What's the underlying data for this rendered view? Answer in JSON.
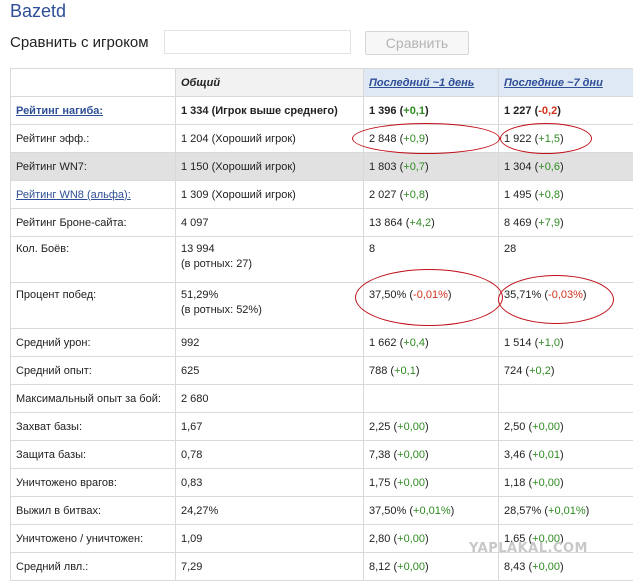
{
  "player": {
    "name": "Bazetd"
  },
  "compare": {
    "label": "Сравнить с игроком",
    "input_value": "",
    "button_label": "Сравнить"
  },
  "table": {
    "headers": {
      "label": "",
      "total": "Общий",
      "day": "Последний ~1 день",
      "week": "Последние ~7 дни"
    },
    "rows": [
      {
        "label": "Рейтинг нагиба:",
        "total": "1 334 (Игрок выше среднего)",
        "day": "1 396",
        "day_delta": "+0,1",
        "day_sign": "pos",
        "week": "1 227",
        "week_delta": "-0,2",
        "week_sign": "neg"
      },
      {
        "label": "Рейтинг эфф.:",
        "total": "1 204 (Хороший игрок)",
        "day": "2 848",
        "day_delta": "+0,9",
        "day_sign": "pos",
        "week": "1 922",
        "week_delta": "+1,5",
        "week_sign": "pos"
      },
      {
        "label": "Рейтинг WN7:",
        "total": "1 150 (Хороший игрок)",
        "day": "1 803",
        "day_delta": "+0,7",
        "day_sign": "pos",
        "week": "1 304",
        "week_delta": "+0,6",
        "week_sign": "pos"
      },
      {
        "label": "Рейтинг WN8 (альфа):",
        "total": "1 309 (Хороший игрок)",
        "day": "2 027",
        "day_delta": "+0,8",
        "day_sign": "pos",
        "week": "1 495",
        "week_delta": "+0,8",
        "week_sign": "pos"
      },
      {
        "label": "Рейтинг Броне-сайта:",
        "total": "4 097",
        "day": "13 864",
        "day_delta": "+4,2",
        "day_sign": "pos",
        "week": "8 469",
        "week_delta": "+7,9",
        "week_sign": "pos"
      },
      {
        "label": "Кол. Боёв:",
        "total": "13 994",
        "total_sub": "(в ротных: 27)",
        "day": "8",
        "week": "28"
      },
      {
        "label": "Процент побед:",
        "total": "51,29%",
        "total_sub": "(в ротных: 52%)",
        "day": "37,50%",
        "day_delta": "-0,01%",
        "day_sign": "neg",
        "week": "35,71%",
        "week_delta": "-0,03%",
        "week_sign": "neg"
      },
      {
        "label": "Средний урон:",
        "total": "992",
        "day": "1 662",
        "day_delta": "+0,4",
        "day_sign": "pos",
        "week": "1 514",
        "week_delta": "+1,0",
        "week_sign": "pos"
      },
      {
        "label": "Средний опыт:",
        "total": "625",
        "day": "788",
        "day_delta": "+0,1",
        "day_sign": "pos",
        "week": "724",
        "week_delta": "+0,2",
        "week_sign": "pos"
      },
      {
        "label": "Максимальный опыт за бой:",
        "total": "2 680"
      },
      {
        "label": "Захват базы:",
        "total": "1,67",
        "day": "2,25",
        "day_delta": "+0,00",
        "day_sign": "pos",
        "week": "2,50",
        "week_delta": "+0,00",
        "week_sign": "pos"
      },
      {
        "label": "Защита базы:",
        "total": "0,78",
        "day": "7,38",
        "day_delta": "+0,00",
        "day_sign": "pos",
        "week": "3,46",
        "week_delta": "+0,01",
        "week_sign": "pos"
      },
      {
        "label": "Уничтожено врагов:",
        "total": "0,83",
        "day": "1,75",
        "day_delta": "+0,00",
        "day_sign": "pos",
        "week": "1,18",
        "week_delta": "+0,00",
        "week_sign": "pos"
      },
      {
        "label": "Выжил в битвах:",
        "total": "24,27%",
        "day": "37,50%",
        "day_delta": "+0,01%",
        "day_sign": "pos",
        "week": "28,57%",
        "week_delta": "+0,01%",
        "week_sign": "pos"
      },
      {
        "label": "Уничтожено / уничтожен:",
        "total": "1,09",
        "day": "2,80",
        "day_delta": "+0,00",
        "day_sign": "pos",
        "week": "1,65",
        "week_delta": "+0,00",
        "week_sign": "pos"
      },
      {
        "label": "Средний лвл.:",
        "total": "7,29",
        "day": "8,12",
        "day_delta": "+0,00",
        "day_sign": "pos",
        "week": "8,43",
        "week_delta": "+0,00",
        "week_sign": "pos"
      }
    ]
  },
  "colors": {
    "accent": "#2e4f96",
    "positive": "#2f8a22",
    "negative": "#d0321d",
    "annotation": "#c0101a"
  },
  "watermark": "YAPLAKAL.COM"
}
